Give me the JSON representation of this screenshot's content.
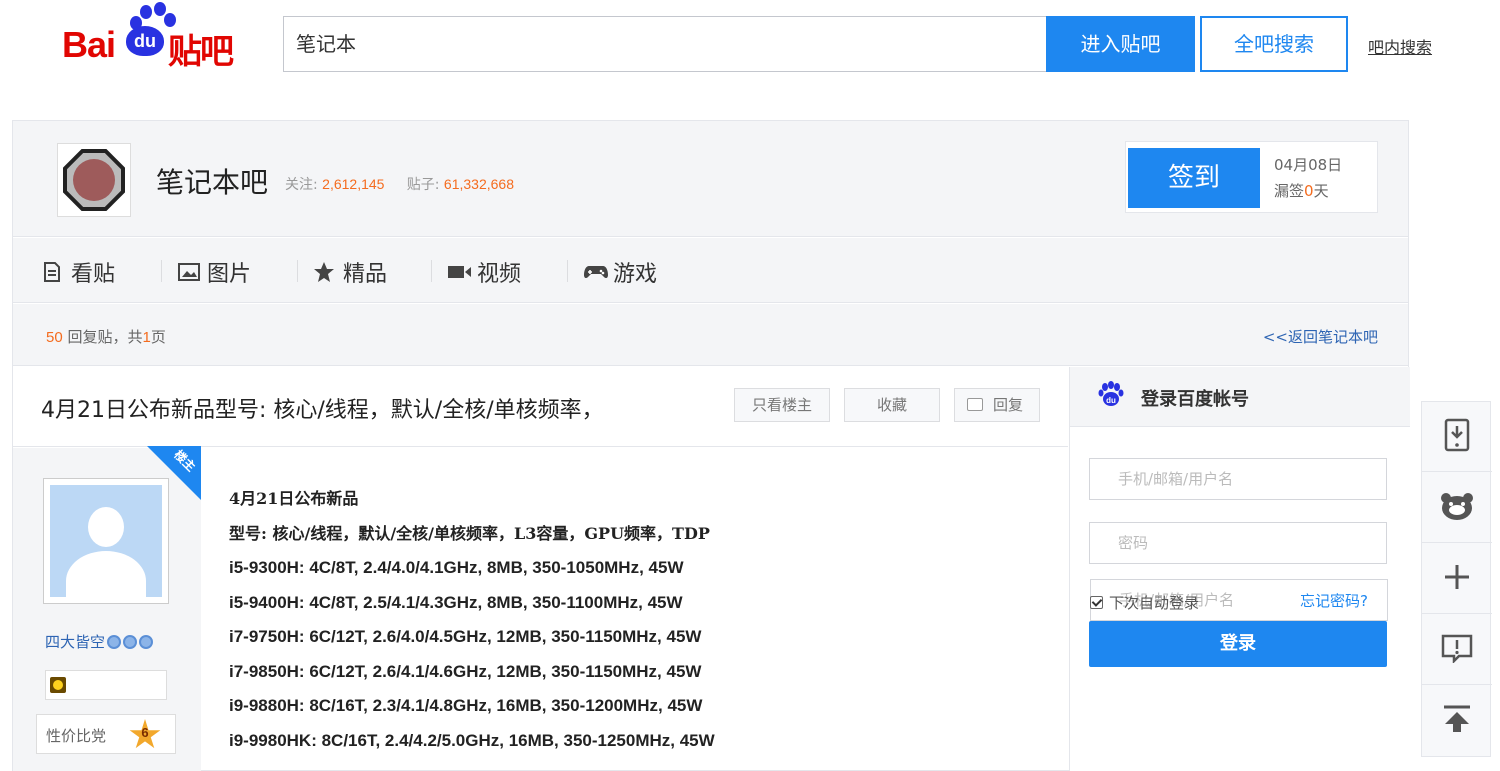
{
  "search": {
    "query": "笔记本",
    "enter_button": "进入贴吧",
    "all_search_button": "全吧搜索",
    "inner_search_link": "吧内搜索"
  },
  "logo": {
    "text_bai": "Bai",
    "text_du": "du",
    "text_tieba": "贴吧"
  },
  "forum": {
    "name": "笔记本吧",
    "follow_label": "关注:",
    "follow_count": "2,612,145",
    "posts_label": "贴子:",
    "posts_count": "61,332,668",
    "signin_button": "签到",
    "signin_date": "04月08日",
    "missed_label_pre": "漏签",
    "missed_days": "0",
    "missed_label_post": "天"
  },
  "nav": {
    "items": [
      {
        "label": "看贴",
        "icon": "document-icon"
      },
      {
        "label": "图片",
        "icon": "image-icon"
      },
      {
        "label": "精品",
        "icon": "star-icon"
      },
      {
        "label": "视频",
        "icon": "video-icon"
      },
      {
        "label": "游戏",
        "icon": "gamepad-icon"
      }
    ]
  },
  "thread_bar": {
    "reply_count": "50",
    "reply_label": "回复贴，共",
    "pages": "1",
    "page_label": "页",
    "back_link": "<<返回笔记本吧"
  },
  "thread": {
    "title": "4月21日公布新品型号: 核心/线程，默认/全核/单核频率，",
    "only_op_button": "只看楼主",
    "favorite_button": "收藏",
    "reply_button": "回复"
  },
  "author": {
    "badge": "楼主",
    "name": "四大皆空",
    "level_title": "性价比党",
    "level": "6"
  },
  "post": {
    "lines": [
      "4月21日公布新品",
      "型号: 核心/线程，默认/全核/单核频率，L3容量，GPU频率，TDP",
      "i5-9300H: 4C/8T, 2.4/4.0/4.1GHz, 8MB, 350-1050MHz, 45W",
      "i5-9400H: 4C/8T, 2.5/4.1/4.3GHz, 8MB, 350-1100MHz, 45W",
      "i7-9750H: 6C/12T, 2.6/4.0/4.5GHz, 12MB, 350-1150MHz, 45W",
      "i7-9850H: 6C/12T, 2.6/4.1/4.6GHz, 12MB, 350-1150MHz, 45W",
      "i9-9880H: 8C/16T, 2.3/4.1/4.8GHz, 16MB, 350-1200MHz, 45W",
      "i9-9980HK: 8C/16T, 2.4/4.2/5.0GHz, 16MB, 350-1250MHz, 45W"
    ]
  },
  "login": {
    "title": "登录百度帐号",
    "username_placeholder": "手机/邮箱/用户名",
    "password_placeholder": "密码",
    "remember_label": "下次自动登录",
    "forgot_link": "忘记密码?",
    "login_button": "登录"
  },
  "side_tools": [
    "download-app-icon",
    "bear-icon",
    "plus-icon",
    "feedback-icon",
    "back-to-top-icon"
  ],
  "colors": {
    "brand_blue": "#1e87f0",
    "brand_red": "#e10602",
    "accent_orange": "#f46c1f",
    "link_blue": "#2d64b3"
  }
}
